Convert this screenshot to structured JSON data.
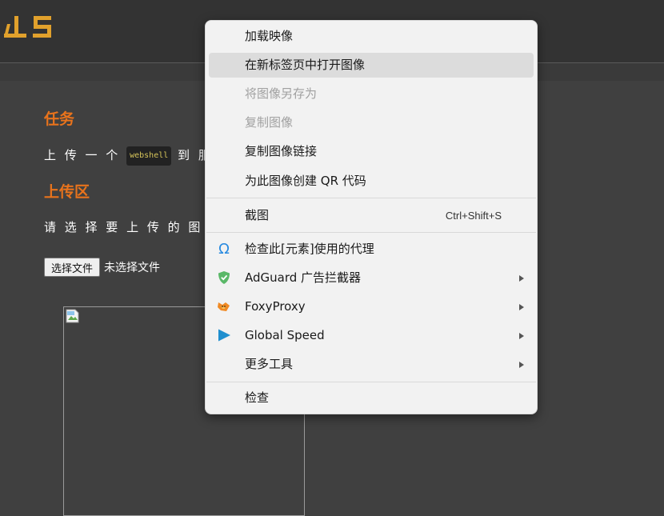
{
  "page": {
    "task_heading": "任务",
    "task_text_before": "上 传 一 个",
    "task_code": "webshell",
    "task_text_after": "到 服",
    "upload_heading": "上传区",
    "upload_prompt": "请 选 择 要 上 传 的 图 片",
    "file_button": "选择文件",
    "file_status": "未选择文件"
  },
  "context_menu": {
    "items": [
      {
        "label": "加载映像"
      },
      {
        "label": "在新标签页中打开图像",
        "state": "hover"
      },
      {
        "label": "将图像另存为",
        "state": "disabled"
      },
      {
        "label": "复制图像",
        "state": "disabled"
      },
      {
        "label": "复制图像链接"
      },
      {
        "label": "为此图像创建 QR 代码"
      },
      {
        "label": "截图",
        "shortcut": "Ctrl+Shift+S"
      },
      {
        "label": "检查此[元素]使用的代理",
        "icon": "omega-icon"
      },
      {
        "label": "AdGuard 广告拦截器",
        "icon": "adguard-shield-icon",
        "submenu": true
      },
      {
        "label": "FoxyProxy",
        "icon": "foxyproxy-fox-icon",
        "submenu": true
      },
      {
        "label": "Global Speed",
        "icon": "play-triangle-icon",
        "submenu": true
      },
      {
        "label": "更多工具",
        "submenu": true
      },
      {
        "label": "检查"
      }
    ]
  },
  "colors": {
    "accent_orange": "#e8731c",
    "menu_bg": "#f2f2f2",
    "menu_hover": "#dcdcdc",
    "page_bg": "#404040"
  }
}
